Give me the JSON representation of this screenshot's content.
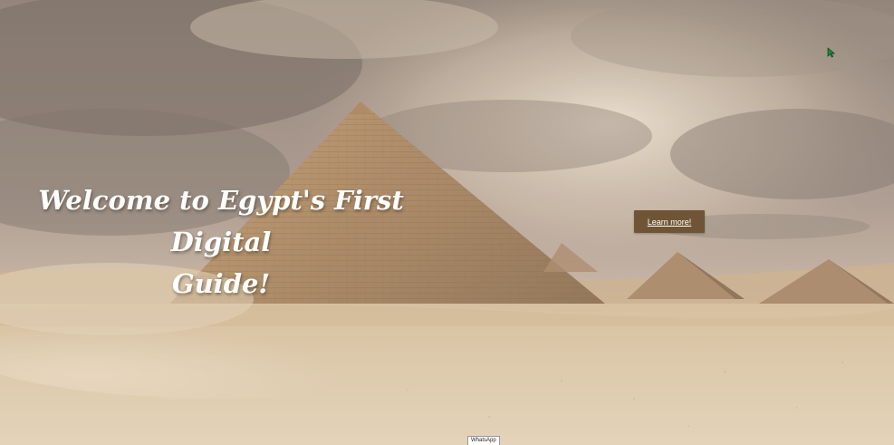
{
  "hero": {
    "title_line1": "Welcome to Egypt's First Digital",
    "title_line2": "Guide!",
    "cta_label": "Learn more!"
  },
  "footer": {
    "whatsapp_label": "WhatsApp"
  },
  "colors": {
    "button_bg": "#6f5535",
    "title_text": "#ffffff",
    "sky_dark": "#7a6d62",
    "sand": "#d8c3a3",
    "pyramid": "#b48e64"
  },
  "icons": {
    "cursor": "mouse-pointer-icon"
  }
}
